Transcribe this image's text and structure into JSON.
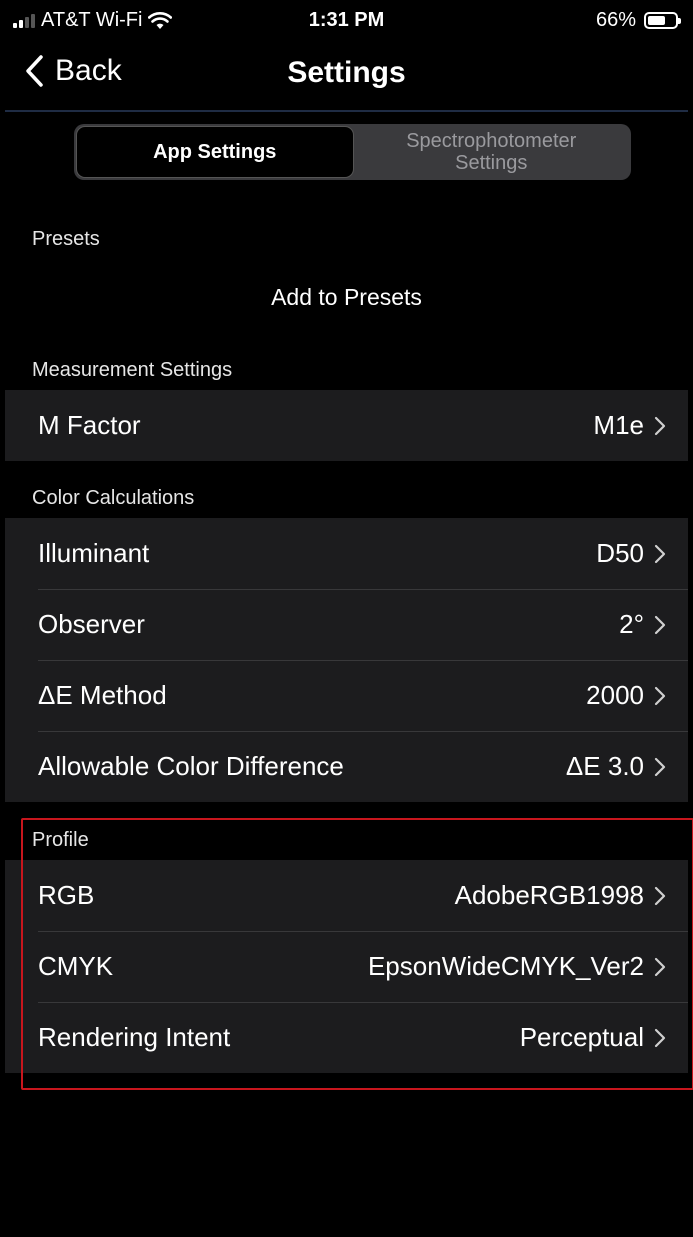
{
  "status_bar": {
    "carrier": "AT&T Wi-Fi",
    "time": "1:31 PM",
    "battery": "66%",
    "battery_level": 0.66
  },
  "nav": {
    "back_label": "Back",
    "title": "Settings"
  },
  "segmented": {
    "app_settings": "App Settings",
    "spectro_line1": "Spectrophotometer",
    "spectro_line2": "Settings"
  },
  "presets": {
    "header": "Presets",
    "add_label": "Add to Presets"
  },
  "measurement": {
    "header": "Measurement Settings",
    "rows": [
      {
        "label": "M Factor",
        "value": "M1e"
      }
    ]
  },
  "color_calc": {
    "header": "Color Calculations",
    "rows": [
      {
        "label": "Illuminant",
        "value": "D50"
      },
      {
        "label": "Observer",
        "value": "2°"
      },
      {
        "label": "ΔE Method",
        "value": "2000"
      },
      {
        "label": "Allowable Color Difference",
        "value": "ΔE 3.0"
      }
    ]
  },
  "profile": {
    "header": "Profile",
    "rows": [
      {
        "label": "RGB",
        "value": "AdobeRGB1998"
      },
      {
        "label": "CMYK",
        "value": "EpsonWideCMYK_Ver2"
      },
      {
        "label": "Rendering Intent",
        "value": "Perceptual"
      }
    ]
  },
  "colors": {
    "background": "#000000",
    "group_background": "#1c1c1e",
    "highlight_border": "#c8161d"
  },
  "icons": {
    "back": "chevron-left-icon",
    "row": "chevron-right-icon",
    "wifi": "wifi-icon",
    "signal": "cellular-signal-icon",
    "battery": "battery-icon"
  }
}
